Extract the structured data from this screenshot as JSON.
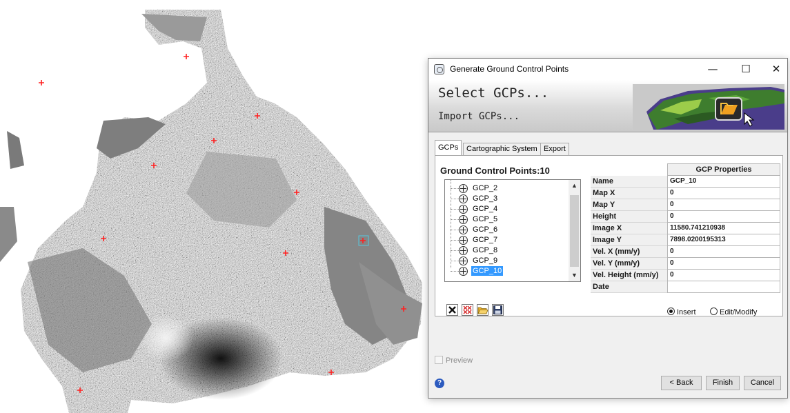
{
  "dialog": {
    "title": "Generate Ground Control Points",
    "window_controls": {
      "minimize": "—",
      "maximize": "☐",
      "close": "✕"
    },
    "header": {
      "select_text": "Select GCPs...",
      "import_text": "Import GCPs..."
    },
    "tabs": [
      {
        "label": "GCPs",
        "active": true
      },
      {
        "label": "Cartographic System",
        "active": false
      },
      {
        "label": "Export",
        "active": false
      }
    ],
    "gcp_list": {
      "label": "Ground Control Points:",
      "count": "10",
      "items": [
        "GCP_2",
        "GCP_3",
        "GCP_4",
        "GCP_5",
        "GCP_6",
        "GCP_7",
        "GCP_8",
        "GCP_9",
        "GCP_10"
      ],
      "selected": "GCP_10"
    },
    "properties": {
      "header": "GCP Properties",
      "rows": [
        {
          "name": "Name",
          "value": "GCP_10"
        },
        {
          "name": "Map X",
          "value": "0"
        },
        {
          "name": "Map Y",
          "value": "0"
        },
        {
          "name": "Height",
          "value": "0"
        },
        {
          "name": "Image X",
          "value": "11580.741210938"
        },
        {
          "name": "Image Y",
          "value": "7898.0200195313"
        },
        {
          "name": "Vel. X (mm/y)",
          "value": "0"
        },
        {
          "name": "Vel. Y (mm/y)",
          "value": "0"
        },
        {
          "name": "Vel. Height (mm/y)",
          "value": "0"
        },
        {
          "name": "Date",
          "value": ""
        }
      ]
    },
    "tool_icons": [
      "delete-icon",
      "delete-all-icon",
      "open-folder-icon",
      "save-icon"
    ],
    "radios": {
      "insert": "Insert",
      "edit": "Edit/Modify",
      "selected": "insert"
    },
    "preview_label": "Preview",
    "help_icon": "?",
    "buttons": {
      "back": "< Back",
      "finish": "Finish",
      "cancel": "Cancel"
    }
  },
  "map": {
    "marker_color": "#ff2020",
    "marker_count": 12
  }
}
